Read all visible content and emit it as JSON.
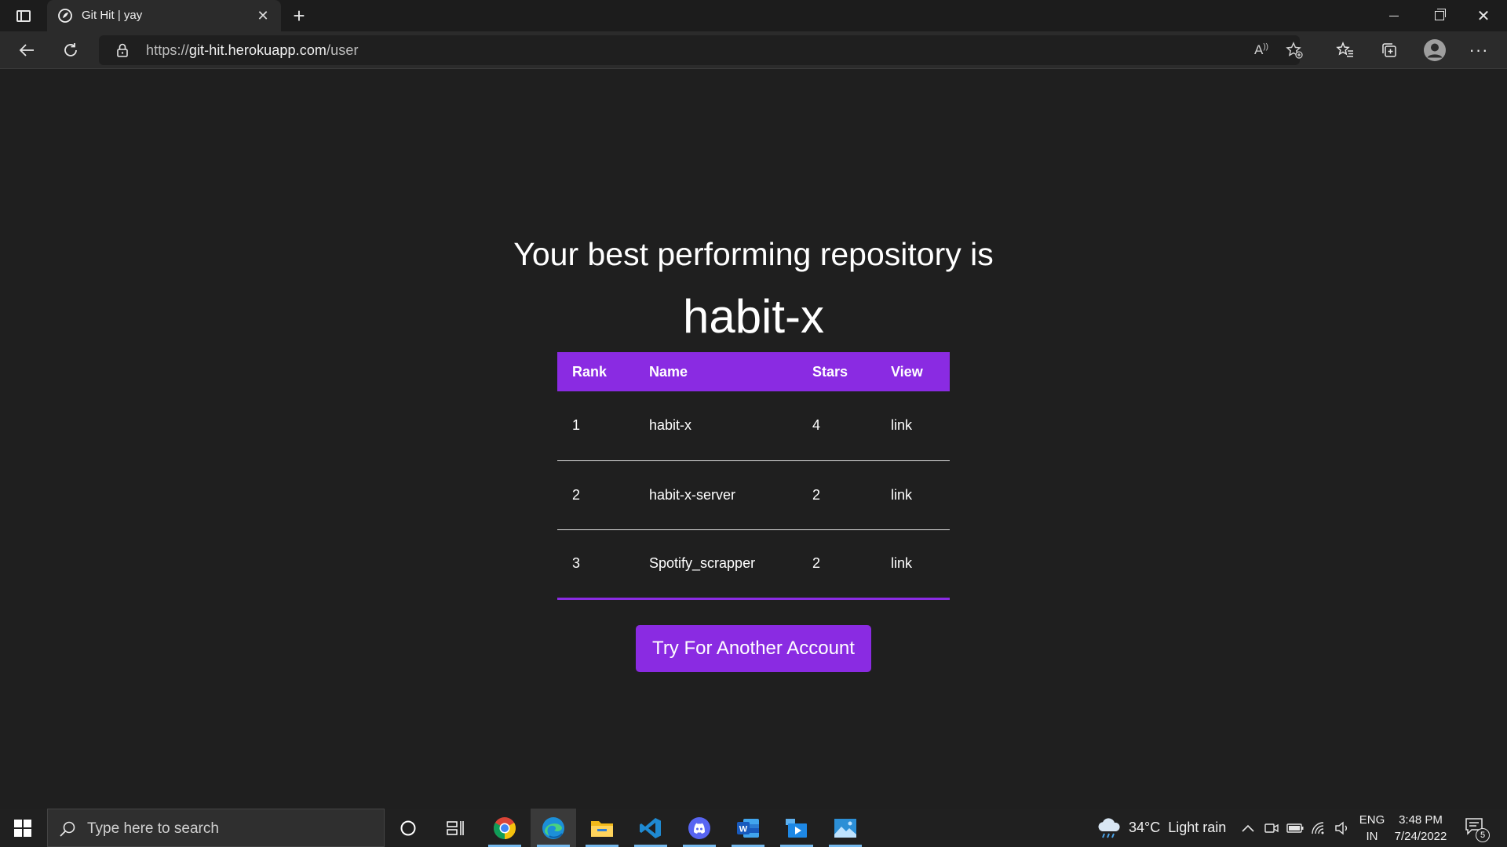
{
  "browser": {
    "tab_title": "Git Hit | yay",
    "url_scheme": "https://",
    "url_host": "git-hit.herokuapp.com",
    "url_path": "/user"
  },
  "page": {
    "heading": "Your best performing repository is",
    "best_repo": "habit-x",
    "table": {
      "headers": [
        "Rank",
        "Name",
        "Stars",
        "View"
      ],
      "rows": [
        {
          "rank": "1",
          "name": "habit-x",
          "stars": "4",
          "view": "link"
        },
        {
          "rank": "2",
          "name": "habit-x-server",
          "stars": "2",
          "view": "link"
        },
        {
          "rank": "3",
          "name": "Spotify_scrapper",
          "stars": "2",
          "view": "link"
        }
      ]
    },
    "cta_label": "Try For Another Account",
    "accent_color": "#8a2be2"
  },
  "taskbar": {
    "search_placeholder": "Type here to search",
    "weather": "34°C  Light rain",
    "lang_line1": "ENG",
    "lang_line2": "IN",
    "time": "3:48 PM",
    "date": "7/24/2022",
    "notification_count": "5",
    "apps": [
      "cortana-icon",
      "task-view-icon",
      "chrome-icon",
      "edge-icon",
      "file-explorer-icon",
      "vscode-icon",
      "discord-icon",
      "word-icon",
      "media-player-icon",
      "photos-icon"
    ]
  }
}
